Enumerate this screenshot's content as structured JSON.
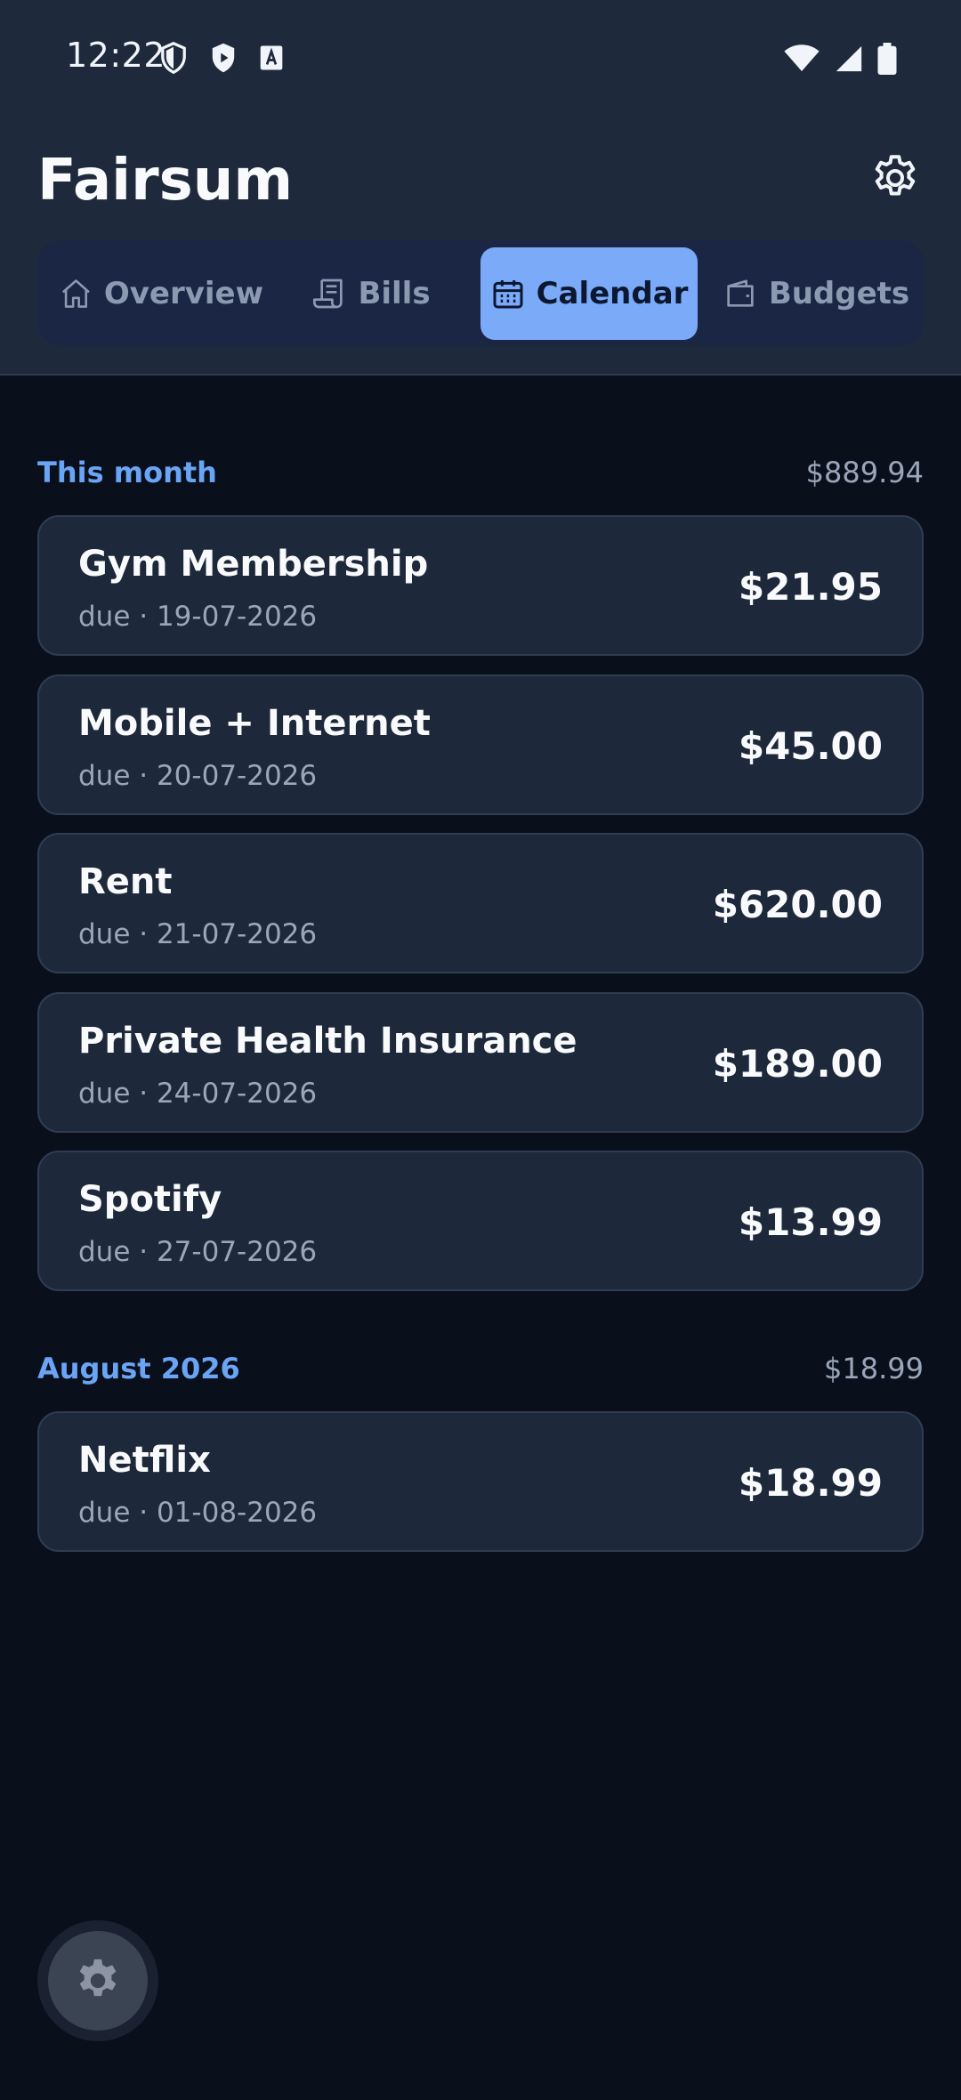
{
  "status_bar": {
    "time": "12:22"
  },
  "app": {
    "title": "Fairsum"
  },
  "tabs": [
    {
      "label": "Overview",
      "icon": "home-icon",
      "active": false
    },
    {
      "label": "Bills",
      "icon": "receipt-icon",
      "active": false
    },
    {
      "label": "Calendar",
      "icon": "calendar-icon",
      "active": true
    },
    {
      "label": "Budgets",
      "icon": "wallet-icon",
      "active": false
    }
  ],
  "sections": [
    {
      "title": "This month",
      "total": "$889.94",
      "bills": [
        {
          "name": "Gym Membership",
          "due": "due · 19-07-2026",
          "amount": "$21.95"
        },
        {
          "name": "Mobile + Internet",
          "due": "due · 20-07-2026",
          "amount": "$45.00"
        },
        {
          "name": "Rent",
          "due": "due · 21-07-2026",
          "amount": "$620.00"
        },
        {
          "name": "Private Health Insurance",
          "due": "due · 24-07-2026",
          "amount": "$189.00"
        },
        {
          "name": "Spotify",
          "due": "due · 27-07-2026",
          "amount": "$13.99"
        }
      ]
    },
    {
      "title": "August 2026",
      "total": "$18.99",
      "bills": [
        {
          "name": "Netflix",
          "due": "due · 01-08-2026",
          "amount": "$18.99"
        }
      ]
    }
  ],
  "colors": {
    "accent": "#7aaaf8",
    "section_title": "#6aa4f5",
    "background": "#0a0f1c",
    "card": "#1d283a",
    "header": "#1e293b"
  }
}
